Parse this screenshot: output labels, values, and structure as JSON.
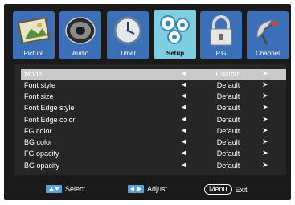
{
  "tabs": [
    {
      "label": "Picture",
      "icon": "picture-icon"
    },
    {
      "label": "Audio",
      "icon": "speaker-icon"
    },
    {
      "label": "Timer",
      "icon": "clock-icon"
    },
    {
      "label": "Setup",
      "icon": "gears-icon",
      "active": true
    },
    {
      "label": "P.G",
      "icon": "lock-icon"
    },
    {
      "label": "Channel",
      "icon": "satellite-dish-icon"
    }
  ],
  "menu": {
    "rows": [
      {
        "label": "Mode",
        "value": "Custom",
        "left": "◄",
        "right": "➤",
        "selected": true
      },
      {
        "label": "Font style",
        "value": "Default",
        "left": "◄",
        "right": "➤"
      },
      {
        "label": "Font size",
        "value": "Default",
        "left": "◄",
        "right": "➤"
      },
      {
        "label": "Font Edge style",
        "value": "Default",
        "left": "◄",
        "right": "➤"
      },
      {
        "label": "Font Edge color",
        "value": "Default",
        "left": "◄",
        "right": "➤"
      },
      {
        "label": "FG color",
        "value": "Default",
        "left": "◄",
        "right": "➤"
      },
      {
        "label": "BG color",
        "value": "Default",
        "left": "◄",
        "right": "➤"
      },
      {
        "label": "FG opacity",
        "value": "Default",
        "left": "◄",
        "right": "➤"
      },
      {
        "label": "BG opacity",
        "value": "Default",
        "left": "◄",
        "right": "➤"
      }
    ]
  },
  "footer": {
    "select_label": "Select",
    "adjust_label": "Adjust",
    "menu_key": "Menu",
    "exit_label": "Exit"
  },
  "colors": {
    "tab_blue": "#3b6fb8",
    "tab_active": "#7fcde0",
    "panel": "#262626",
    "selected_row": "#c9c9c9"
  }
}
